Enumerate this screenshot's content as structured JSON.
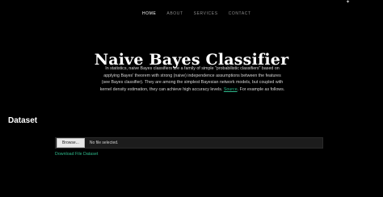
{
  "nav": {
    "items": [
      {
        "label": "HOME",
        "active": true
      },
      {
        "label": "ABOUT",
        "active": false
      },
      {
        "label": "SERVICES",
        "active": false
      },
      {
        "label": "CONTACT",
        "active": false
      }
    ]
  },
  "corner": {
    "icon": "sparkle-icon"
  },
  "hero": {
    "title": "Naive Bayes Classifier",
    "paragraph_before_link": "In statistics, naive Bayes classifiers are a family of simple \"probabilistic classifiers\" based on applying Bayes' theorem with strong (naive) independence assumptions between the features (see Bayes classifier). They are among the simplest Bayesian network models, but coupled with kernel density estimation, they can achieve high accuracy levels.",
    "link_text": "Source",
    "paragraph_after_link": ". For example as follows."
  },
  "dataset": {
    "title": "Dataset",
    "browse_label": "Browse...",
    "file_status": "No file selected.",
    "download_label": "Download File Dataset"
  },
  "colors": {
    "background": "#000000",
    "accent_link": "#2eb88a",
    "nav_active": "#ffffff",
    "nav_inactive": "#8a8a8a"
  }
}
